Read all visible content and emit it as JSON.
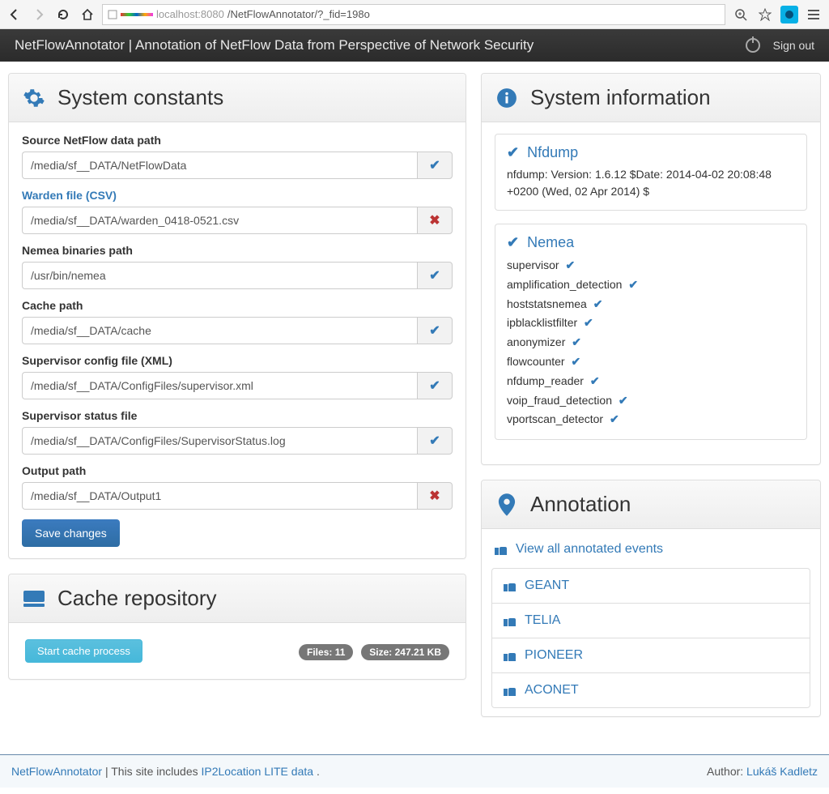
{
  "browser": {
    "url_host": "localhost:8080",
    "url_path": "/NetFlowAnnotator/?_fid=198o"
  },
  "header": {
    "title": "NetFlowAnnotator | Annotation of NetFlow Data from Perspective of Network Security",
    "signout": "Sign out"
  },
  "constants": {
    "title": "System constants",
    "fields": [
      {
        "label": "Source NetFlow data path",
        "value": "/media/sf__DATA/NetFlowData",
        "ok": true,
        "link": false
      },
      {
        "label": "Warden file (CSV)",
        "value": "/media/sf__DATA/warden_0418-0521.csv",
        "ok": false,
        "link": true
      },
      {
        "label": "Nemea binaries path",
        "value": "/usr/bin/nemea",
        "ok": true,
        "link": false
      },
      {
        "label": "Cache path",
        "value": "/media/sf__DATA/cache",
        "ok": true,
        "link": false
      },
      {
        "label": "Supervisor config file (XML)",
        "value": "/media/sf__DATA/ConfigFiles/supervisor.xml",
        "ok": true,
        "link": false
      },
      {
        "label": "Supervisor status file",
        "value": "/media/sf__DATA/ConfigFiles/SupervisorStatus.log",
        "ok": true,
        "link": false
      },
      {
        "label": "Output path",
        "value": "/media/sf__DATA/Output1",
        "ok": false,
        "link": false
      }
    ],
    "save": "Save changes"
  },
  "cache": {
    "title": "Cache repository",
    "start": "Start cache process",
    "files_label": "Files: 11",
    "size_label": "Size: 247.21 KB"
  },
  "sysinfo": {
    "title": "System information",
    "nfdump_title": "Nfdump",
    "nfdump_text": "nfdump: Version: 1.6.12 $Date: 2014-04-02 20:08:48 +0200 (Wed, 02 Apr 2014) $",
    "nemea_title": "Nemea",
    "modules": [
      "supervisor",
      "amplification_detection",
      "hoststatsnemea",
      "ipblacklistfilter",
      "anonymizer",
      "flowcounter",
      "nfdump_reader",
      "voip_fraud_detection",
      "vportscan_detector"
    ]
  },
  "annotation": {
    "title": "Annotation",
    "view_all": "View all annotated events",
    "items": [
      "GEANT",
      "TELIA",
      "PIONEER",
      "ACONET"
    ]
  },
  "footer": {
    "brand": "NetFlowAnnotator",
    "text": "  |  This site includes ",
    "ip2loc": "IP2Location LITE data",
    "dot": ".",
    "author_label": "Author: ",
    "author": "Lukáš Kadletz"
  }
}
